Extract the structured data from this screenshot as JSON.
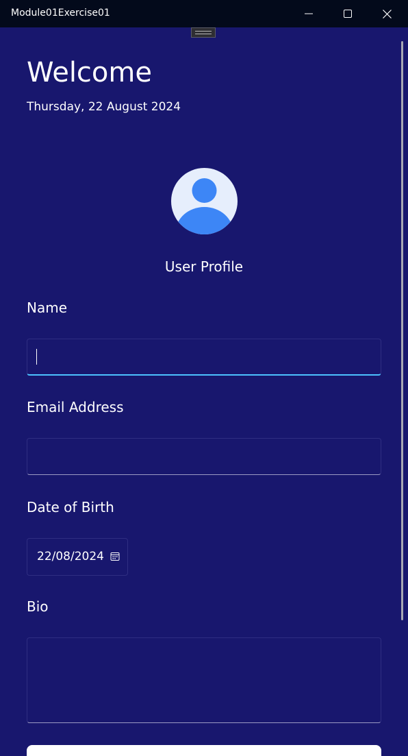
{
  "window": {
    "title": "Module01Exercise01"
  },
  "header": {
    "welcome": "Welcome",
    "date": "Thursday, 22 August 2024"
  },
  "profile": {
    "label": "User Profile"
  },
  "form": {
    "name_label": "Name",
    "name_value": "",
    "email_label": "Email Address",
    "email_value": "",
    "dob_label": "Date of Birth",
    "dob_value": "22/08/2024",
    "bio_label": "Bio",
    "bio_value": ""
  },
  "colors": {
    "background": "#18176e",
    "titlebar": "#030a1b",
    "focus_accent": "#4cc2ff",
    "avatar_bg": "#e6eefc",
    "avatar_figure": "#3d86f6"
  }
}
